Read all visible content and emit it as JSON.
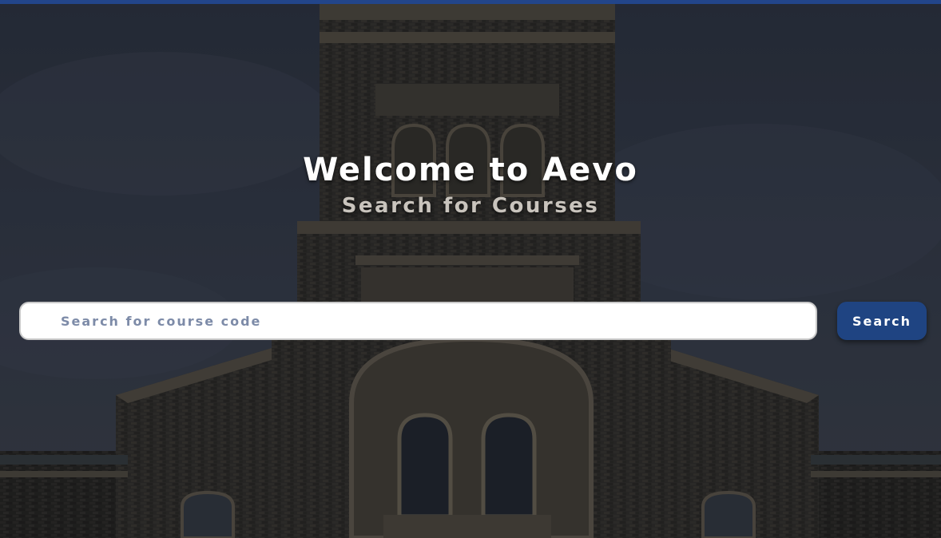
{
  "hero": {
    "title": "Welcome to Aevo",
    "subtitle": "Search for Courses"
  },
  "search": {
    "placeholder": "Search for course code",
    "value": "",
    "button_label": "Search"
  },
  "colors": {
    "top_bar": "#22458a",
    "button": "#1f4482",
    "placeholder": "#7d8ba8"
  }
}
